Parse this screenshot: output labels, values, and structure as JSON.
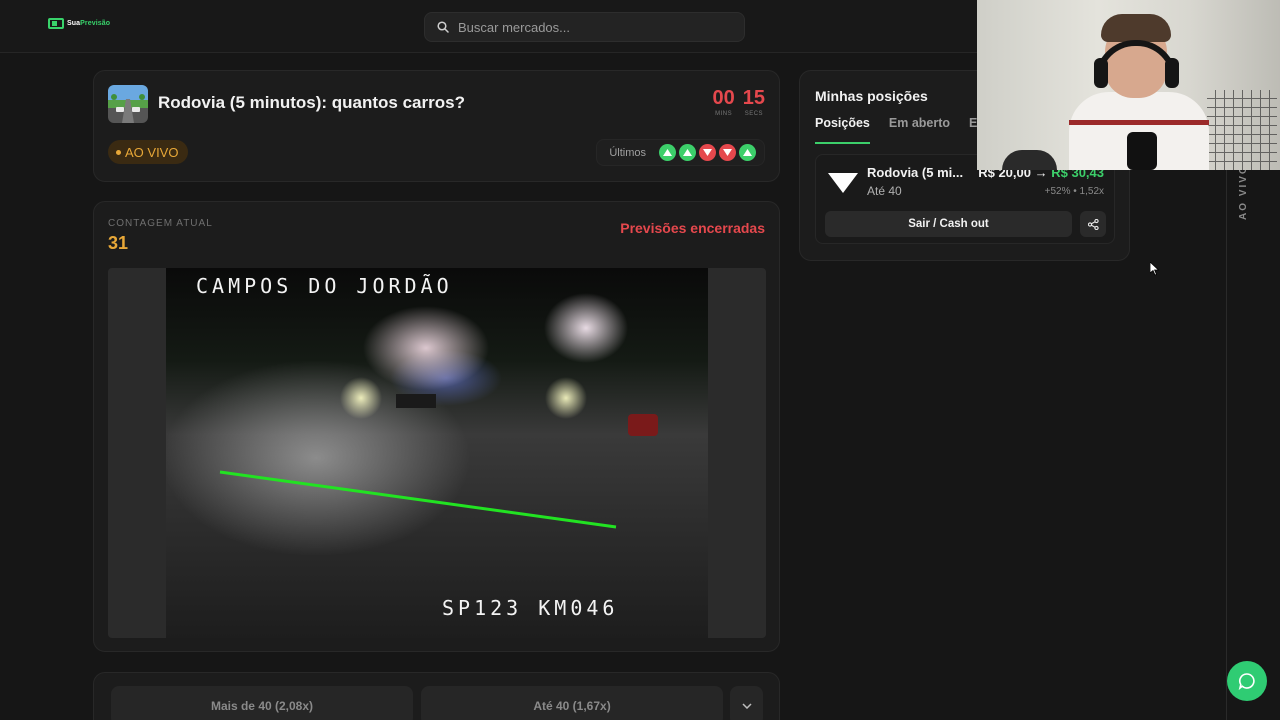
{
  "brand": {
    "name_part1": "Sua",
    "name_part2": "Previsão",
    "accent_color": "#39d36b"
  },
  "search": {
    "placeholder": "Buscar mercados..."
  },
  "market": {
    "title": "Rodovia (5 minutos): quantos carros?",
    "timer": {
      "minutes": "00",
      "minutes_label": "MINS",
      "seconds": "15",
      "seconds_label": "SECS"
    },
    "status": "AO VIVO",
    "recent_label": "Últimos",
    "recent_results": [
      "up",
      "up",
      "down",
      "down",
      "up"
    ]
  },
  "live_count": {
    "label": "CONTAGEM ATUAL",
    "value": "31",
    "predictions_status": "Previsões encerradas"
  },
  "video": {
    "caption_top": "CAMPOS DO JORDÃO",
    "caption_bottom": "SP123 KM046"
  },
  "bet_options": [
    {
      "label": "Mais de 40  (2,08x)"
    },
    {
      "label": "Até 40  (1,67x)"
    }
  ],
  "positions": {
    "title": "Minhas posições",
    "tabs": [
      "Posições",
      "Em aberto",
      "E"
    ],
    "item": {
      "name": "Rodovia (5 mi...",
      "outcome": "Até 40",
      "stake": "R$ 20,00",
      "arrow": "→",
      "payout": "R$ 30,43",
      "meta": "+52% • 1,52x",
      "cashout_label": "Sair / Cash out"
    }
  },
  "rail": {
    "label": "AO VIVO"
  },
  "colors": {
    "live": "#e8a838",
    "danger": "#e5484d",
    "success": "#3ccf6a"
  }
}
